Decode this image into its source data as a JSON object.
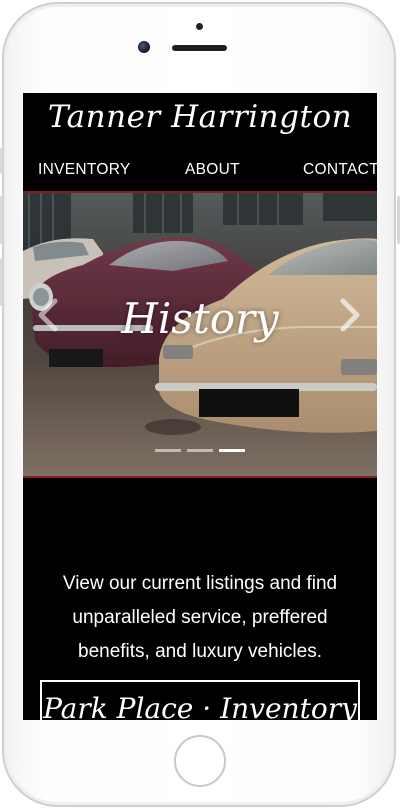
{
  "site": {
    "brand": "Tanner Harrington"
  },
  "nav": {
    "items": [
      {
        "label": "INVENTORY"
      },
      {
        "label": "ABOUT"
      },
      {
        "label": "CONTACT"
      }
    ]
  },
  "hero": {
    "title": "History",
    "slides_total": 3,
    "active_slide": 3,
    "accent_color": "#8b1a23"
  },
  "intro": {
    "text": "View our current listings and find unparalleled service, preffered benefits, and luxury vehicles."
  },
  "cta": {
    "label": "Park Place · Inventory"
  },
  "icons": {
    "prev": "chevron-left-icon",
    "next": "chevron-right-icon"
  }
}
